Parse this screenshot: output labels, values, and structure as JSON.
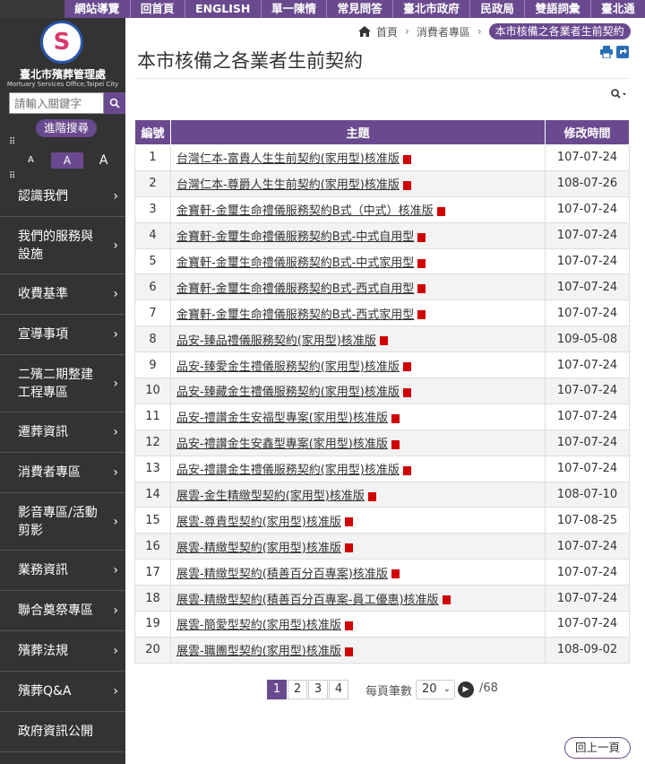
{
  "top_nav": {
    "items": [
      "網站導覽",
      "回首頁",
      "ENGLISH",
      "單一陳情",
      "常見問答",
      "臺北市政府",
      "民政局",
      "雙語詞彙",
      "臺北通"
    ]
  },
  "sidebar": {
    "logo": {
      "title": "臺北市殯葬管理處",
      "subtitle": "Mortuary Services Office,Taipei City",
      "mark": "S"
    },
    "search": {
      "placeholder": "請輸入關鍵字",
      "advanced_label": "進階搜尋"
    },
    "font_size": {
      "small": "A",
      "medium": "A",
      "large": "A"
    },
    "menu": [
      "認識我們",
      "我們的服務與設施",
      "收費基準",
      "宣導事項",
      "二殯二期整建工程專區",
      "遷葬資訊",
      "消費者專區",
      "影音專區/活動剪影",
      "業務資訊",
      "聯合奠祭專區",
      "殯葬法規",
      "殯葬Q&A",
      "政府資訊公開"
    ]
  },
  "breadcrumb": {
    "home": "首頁",
    "section": "消費者專區",
    "current": "本市核備之各業者生前契約"
  },
  "page": {
    "title": "本市核備之各業者生前契約"
  },
  "table": {
    "headers": {
      "num": "編號",
      "title": "主題",
      "date": "修改時間"
    },
    "rows": [
      {
        "num": "1",
        "title": "台灣仁本-富貴人生生前契約(家用型)核准版",
        "date": "107-07-24"
      },
      {
        "num": "2",
        "title": "台灣仁本-尊爵人生生前契約(家用型)核准版",
        "date": "108-07-26"
      },
      {
        "num": "3",
        "title": "金寶軒-金璽生命禮儀服務契約B式（中式）核准版",
        "date": "107-07-24"
      },
      {
        "num": "4",
        "title": "金寶軒-金璽生命禮儀服務契約B式-中式自用型",
        "date": "107-07-24"
      },
      {
        "num": "5",
        "title": "金寶軒-金璽生命禮儀服務契約B式-中式家用型",
        "date": "107-07-24"
      },
      {
        "num": "6",
        "title": "金寶軒-金璽生命禮儀服務契約B式-西式自用型",
        "date": "107-07-24"
      },
      {
        "num": "7",
        "title": "金寶軒-金璽生命禮儀服務契約B式-西式家用型",
        "date": "107-07-24"
      },
      {
        "num": "8",
        "title": "品安-臻品禮儀服務契約(家用型)核准版",
        "date": "109-05-08"
      },
      {
        "num": "9",
        "title": "品安-臻愛金生禮儀服務契約(家用型)核准版",
        "date": "107-07-24"
      },
      {
        "num": "10",
        "title": "品安-臻藏金生禮儀服務契約(家用型)核准版",
        "date": "107-07-24"
      },
      {
        "num": "11",
        "title": "品安-禮讚金生安福型專案(家用型)核准版",
        "date": "107-07-24"
      },
      {
        "num": "12",
        "title": "品安-禮讚金生安鑫型專案(家用型)核准版",
        "date": "107-07-24"
      },
      {
        "num": "13",
        "title": "品安-禮讚金生禮儀服務契約(家用型)核准版",
        "date": "107-07-24"
      },
      {
        "num": "14",
        "title": "展雲-金生精緻型契約(家用型)核准版",
        "date": "108-07-10"
      },
      {
        "num": "15",
        "title": "展雲-尊貴型契約(家用型)核准版",
        "date": "107-08-25"
      },
      {
        "num": "16",
        "title": "展雲-精緻型契約(家用型)核准版",
        "date": "107-07-24"
      },
      {
        "num": "17",
        "title": "展雲-精緻型契約(積善百分百專案)核准版",
        "date": "107-07-24"
      },
      {
        "num": "18",
        "title": "展雲-精緻型契約(積善百分百專案-員工優惠)核准版",
        "date": "107-07-24"
      },
      {
        "num": "19",
        "title": "展雲-簡愛型契約(家用型)核准版",
        "date": "107-07-24"
      },
      {
        "num": "20",
        "title": "展雲-職團型契約(家用型)核准版",
        "date": "108-09-02"
      }
    ]
  },
  "pagination": {
    "pages": [
      "1",
      "2",
      "3",
      "4"
    ],
    "active": "1",
    "per_page_label": "每頁筆數",
    "per_page_value": "20",
    "total": "/68"
  },
  "back_button": "回上一頁",
  "icons": {
    "pdf": "pdf-icon",
    "home": "home-icon",
    "print": "print-icon",
    "share": "share-icon",
    "search": "search-icon"
  },
  "colors": {
    "accent": "#6a4a8f",
    "sidebar": "#333333",
    "pdf": "#d00000"
  }
}
